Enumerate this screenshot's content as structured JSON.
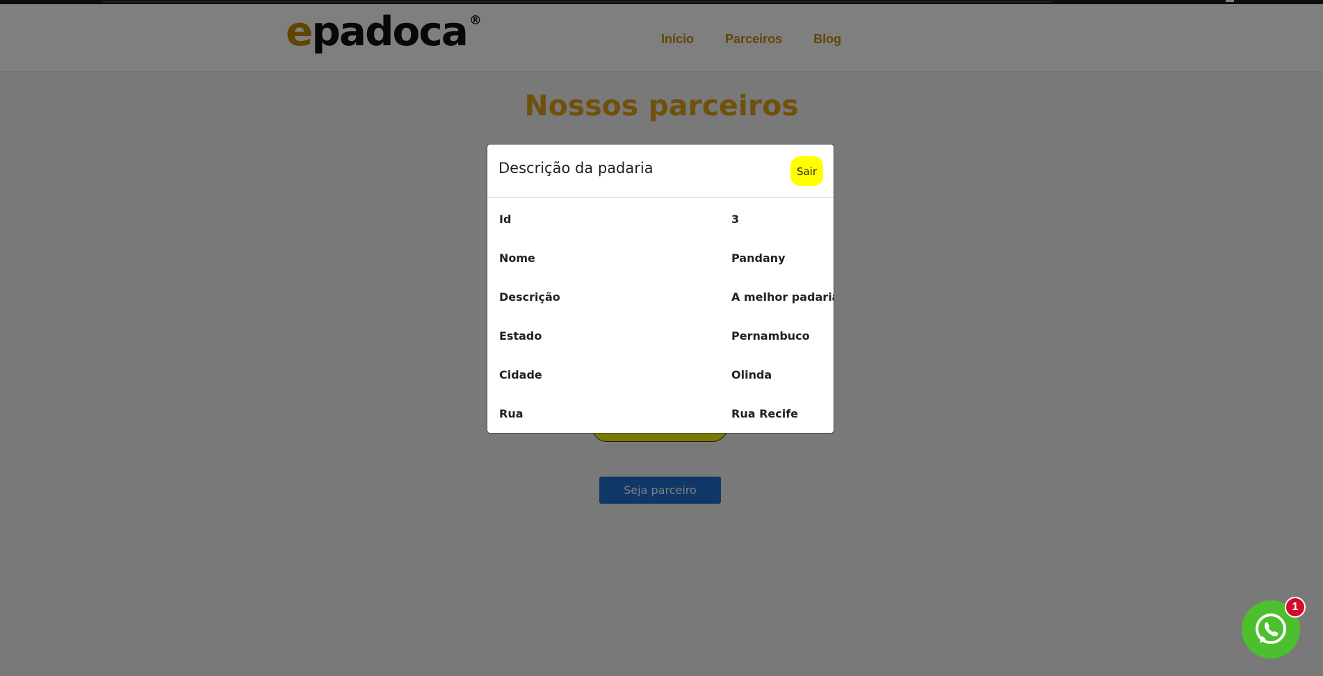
{
  "brand": {
    "logo_e": "e",
    "logo_rest": "padoca",
    "logo_reg": "®"
  },
  "nav": {
    "items": [
      {
        "label": "Início"
      },
      {
        "label": "Parceiros"
      },
      {
        "label": "Blog"
      }
    ]
  },
  "main": {
    "title": "Nossos parceiros",
    "partner_button": "Seja parceiro"
  },
  "modal": {
    "title": "Descrição da padaria",
    "close_label": "Sair",
    "rows": [
      {
        "label": "Id",
        "value": "3"
      },
      {
        "label": "Nome",
        "value": "Pandany"
      },
      {
        "label": "Descrição",
        "value": "A melhor padaria"
      },
      {
        "label": "Estado",
        "value": "Pernambuco"
      },
      {
        "label": "Cidade",
        "value": "Olinda"
      },
      {
        "label": "Rua",
        "value": "Rua Recife"
      }
    ]
  },
  "whatsapp": {
    "badge_count": "1",
    "icon": "whatsapp-icon"
  },
  "colors": {
    "brand_gold": "#c58b0a",
    "title_gold": "#e0a11b",
    "close_yellow": "#ffff00",
    "partner_blue": "#1f6fd0",
    "whatsapp_green": "#4cbf2e",
    "badge_red": "#d60a2a"
  }
}
